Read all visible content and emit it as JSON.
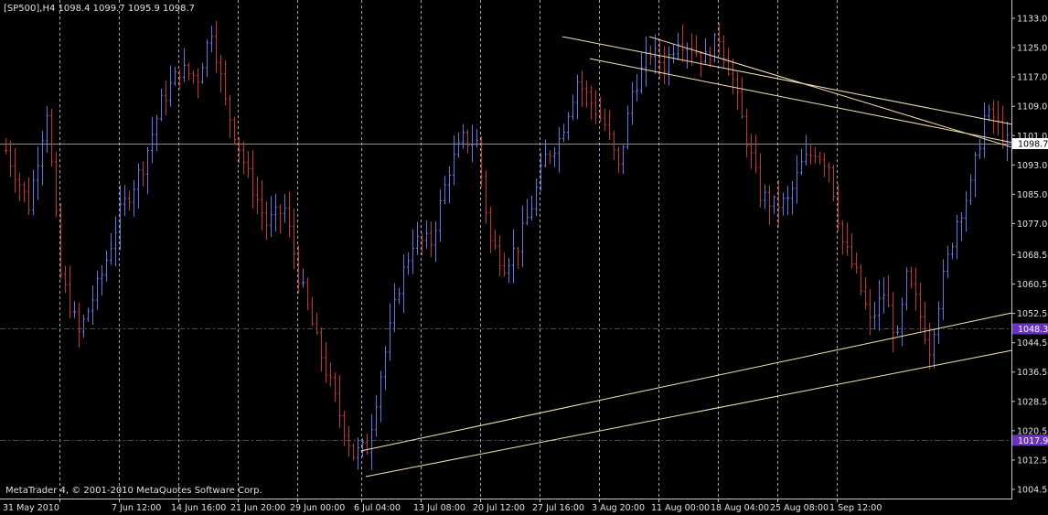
{
  "window": {
    "symbol_label": "[SP500],H4",
    "ohlc_label": "1098.4 1099.7 1095.9 1098.7",
    "copyright": "MetaTrader 4, © 2001-2010 MetaQuotes Software Corp."
  },
  "colors": {
    "background": "#000000",
    "axis": "#c8c8c8",
    "grid": "#c8c8c8",
    "bull": "#5a78e6",
    "bear": "#c83228",
    "trendline": "#f5e4b4",
    "level_line": "#5b2bd8",
    "price_line": "#b4b4b4",
    "badge_bg": "#6a31c8"
  },
  "chart_data": {
    "type": "line",
    "ylim": [
      1002.0,
      1138.0
    ],
    "y_ticks": [
      1133.0,
      1125.0,
      1117.0,
      1109.0,
      1101.0,
      1093.0,
      1085.0,
      1077.0,
      1068.5,
      1060.5,
      1052.5,
      1044.5,
      1036.5,
      1028.5,
      1020.5,
      1012.5,
      1004.5
    ],
    "y_tick_labels": [
      "1133.0",
      "1125.0",
      "1117.0",
      "1109.0",
      "1101.0",
      "1093.0",
      "1085.0",
      "1077.0",
      "1068.5",
      "1060.5",
      "1052.5",
      "1044.5",
      "1036.5",
      "1028.5",
      "1020.5",
      "1012.5",
      "1004.5"
    ],
    "x_labels": [
      "31 May 2010",
      "7 Jun 12:00",
      "14 Jun 16:00",
      "21 Jun 20:00",
      "29 Jun 00:00",
      "6 Jul 04:00",
      "13 Jul 08:00",
      "20 Jul 12:00",
      "27 Jul 16:00",
      "3 Aug 20:00",
      "11 Aug 00:00",
      "18 Aug 04:00",
      "25 Aug 08:00",
      "1 Sep 12:00"
    ],
    "bar_count": 220,
    "grid": true,
    "current_price": 1098.7,
    "current_price_label": "1098.7",
    "horizontal_levels": [
      {
        "price": 1048.3,
        "label": "1048.3"
      },
      {
        "price": 1017.9,
        "label": "1017.9"
      }
    ],
    "close_path": [
      {
        "bar": 0,
        "price": 1097
      },
      {
        "bar": 5,
        "price": 1082
      },
      {
        "bar": 9,
        "price": 1108
      },
      {
        "bar": 12,
        "price": 1063
      },
      {
        "bar": 16,
        "price": 1047
      },
      {
        "bar": 21,
        "price": 1063
      },
      {
        "bar": 25,
        "price": 1080
      },
      {
        "bar": 30,
        "price": 1093
      },
      {
        "bar": 34,
        "price": 1110
      },
      {
        "bar": 38,
        "price": 1119
      },
      {
        "bar": 42,
        "price": 1117
      },
      {
        "bar": 45,
        "price": 1130
      },
      {
        "bar": 48,
        "price": 1110
      },
      {
        "bar": 53,
        "price": 1090
      },
      {
        "bar": 57,
        "price": 1077
      },
      {
        "bar": 61,
        "price": 1081
      },
      {
        "bar": 64,
        "price": 1063
      },
      {
        "bar": 68,
        "price": 1045
      },
      {
        "bar": 73,
        "price": 1025
      },
      {
        "bar": 76,
        "price": 1014
      },
      {
        "bar": 79,
        "price": 1016
      },
      {
        "bar": 82,
        "price": 1036
      },
      {
        "bar": 86,
        "price": 1060
      },
      {
        "bar": 89,
        "price": 1072
      },
      {
        "bar": 93,
        "price": 1072
      },
      {
        "bar": 97,
        "price": 1092
      },
      {
        "bar": 100,
        "price": 1100
      },
      {
        "bar": 103,
        "price": 1099
      },
      {
        "bar": 106,
        "price": 1072
      },
      {
        "bar": 109,
        "price": 1066
      },
      {
        "bar": 112,
        "price": 1071
      },
      {
        "bar": 115,
        "price": 1082
      },
      {
        "bar": 118,
        "price": 1095
      },
      {
        "bar": 121,
        "price": 1100
      },
      {
        "bar": 125,
        "price": 1116
      },
      {
        "bar": 128,
        "price": 1110
      },
      {
        "bar": 131,
        "price": 1104
      },
      {
        "bar": 134,
        "price": 1092
      },
      {
        "bar": 137,
        "price": 1113
      },
      {
        "bar": 141,
        "price": 1124
      },
      {
        "bar": 144,
        "price": 1120
      },
      {
        "bar": 147,
        "price": 1128
      },
      {
        "bar": 150,
        "price": 1125
      },
      {
        "bar": 153,
        "price": 1122
      },
      {
        "bar": 156,
        "price": 1128
      },
      {
        "bar": 159,
        "price": 1116
      },
      {
        "bar": 162,
        "price": 1100
      },
      {
        "bar": 165,
        "price": 1085
      },
      {
        "bar": 168,
        "price": 1082
      },
      {
        "bar": 171,
        "price": 1083
      },
      {
        "bar": 174,
        "price": 1093
      },
      {
        "bar": 177,
        "price": 1097
      },
      {
        "bar": 180,
        "price": 1093
      },
      {
        "bar": 183,
        "price": 1072
      },
      {
        "bar": 186,
        "price": 1063
      },
      {
        "bar": 189,
        "price": 1050
      },
      {
        "bar": 192,
        "price": 1058
      },
      {
        "bar": 195,
        "price": 1045
      },
      {
        "bar": 197,
        "price": 1062
      },
      {
        "bar": 199,
        "price": 1056
      },
      {
        "bar": 202,
        "price": 1043
      },
      {
        "bar": 205,
        "price": 1062
      },
      {
        "bar": 208,
        "price": 1078
      },
      {
        "bar": 211,
        "price": 1087
      },
      {
        "bar": 214,
        "price": 1106
      },
      {
        "bar": 216,
        "price": 1106
      },
      {
        "bar": 219,
        "price": 1099
      }
    ],
    "trendlines": [
      {
        "bar1": 122,
        "price1": 1128.0,
        "bar2": 233,
        "price2": 1101.0
      },
      {
        "bar1": 141,
        "price1": 1128.0,
        "bar2": 233,
        "price2": 1093.0
      },
      {
        "bar1": 128,
        "price1": 1122.0,
        "bar2": 233,
        "price2": 1096.0
      },
      {
        "bar1": 78,
        "price1": 1015.0,
        "bar2": 233,
        "price2": 1056.0
      },
      {
        "bar1": 79,
        "price1": 1008.0,
        "bar2": 233,
        "price2": 1045.5
      }
    ]
  }
}
